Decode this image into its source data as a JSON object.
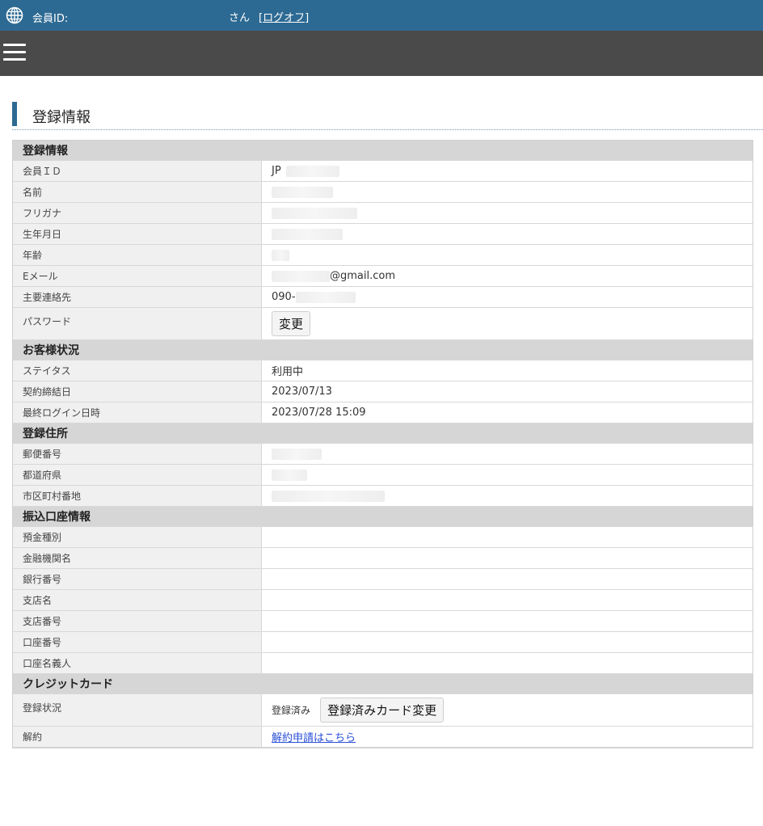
{
  "header": {
    "member_label": "会員ID:",
    "san": "さん",
    "logoff": "[ログオフ]"
  },
  "page_title": "登録情報",
  "groups": {
    "registration": {
      "title": "登録情報",
      "rows": {
        "member_id": {
          "label": "会員ＩＤ",
          "value": "JP"
        },
        "name": {
          "label": "名前"
        },
        "furigana": {
          "label": "フリガナ"
        },
        "birthdate": {
          "label": "生年月日"
        },
        "age": {
          "label": "年齢"
        },
        "email": {
          "label": "Eメール",
          "value": "@gmail.com"
        },
        "phone": {
          "label": "主要連絡先",
          "value": "090-"
        },
        "password": {
          "label": "パスワード",
          "button": "変更"
        }
      }
    },
    "customer_status": {
      "title": "お客様状況",
      "rows": {
        "status": {
          "label": "ステイタス",
          "value": "利用中"
        },
        "contract_date": {
          "label": "契約締結日",
          "value": "2023/07/13"
        },
        "last_login": {
          "label": "最終ログイン日時",
          "value": "2023/07/28 15:09"
        }
      }
    },
    "address": {
      "title": "登録住所",
      "rows": {
        "postal": {
          "label": "郵便番号"
        },
        "prefecture": {
          "label": "都道府県"
        },
        "city": {
          "label": "市区町村番地"
        }
      }
    },
    "bank": {
      "title": "振込口座情報",
      "rows": {
        "deposit_type": {
          "label": "預金種別"
        },
        "bank_name": {
          "label": "金融機関名"
        },
        "bank_code": {
          "label": "銀行番号"
        },
        "branch_name": {
          "label": "支店名"
        },
        "branch_code": {
          "label": "支店番号"
        },
        "account_number": {
          "label": "口座番号"
        },
        "account_holder": {
          "label": "口座名義人"
        }
      }
    },
    "credit_card": {
      "title": "クレジットカード",
      "rows": {
        "reg_status": {
          "label": "登録状況",
          "value": "登録済み",
          "button": "登録済みカード変更"
        },
        "cancel": {
          "label": "解約",
          "link": "解約申請はこちら"
        }
      }
    }
  },
  "colors": {
    "topbar": "#2d6a93",
    "navbar": "#4a4a4a",
    "group_header": "#d6d6d6",
    "label_bg": "#f0f0f0",
    "link": "#2a4fd6"
  }
}
